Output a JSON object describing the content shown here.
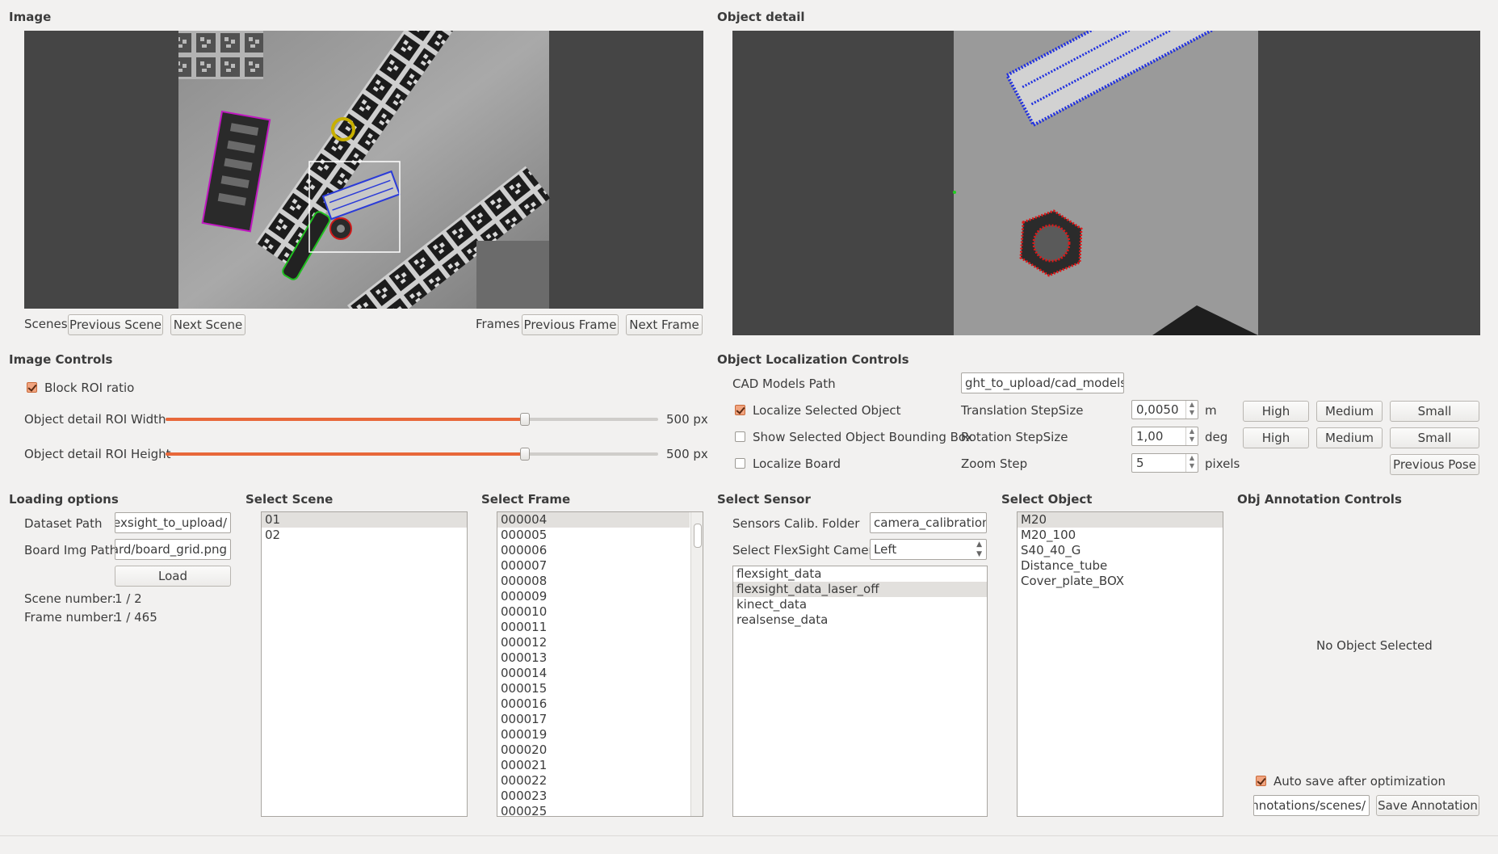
{
  "panels": {
    "image": "Image",
    "object_detail": "Object detail",
    "image_controls": "Image Controls",
    "object_localization": "Object Localization Controls",
    "loading_options": "Loading options",
    "select_scene": "Select Scene",
    "select_frame": "Select Frame",
    "select_sensor": "Select Sensor",
    "select_object": "Select Object",
    "obj_annotation": "Obj Annotation Controls"
  },
  "nav": {
    "scenes_label": "Scenes",
    "prev_scene": "Previous Scene",
    "next_scene": "Next Scene",
    "frames_label": "Frames",
    "prev_frame": "Previous Frame",
    "next_frame": "Next Frame"
  },
  "image_controls": {
    "block_roi_label": "Block ROI ratio",
    "block_roi_checked": true,
    "roi_width_label": "Object detail ROI Width",
    "roi_width_value": "500 px",
    "roi_width_fraction": 0.73,
    "roi_height_label": "Object detail ROI Height",
    "roi_height_value": "500 px",
    "roi_height_fraction": 0.73
  },
  "localization": {
    "cad_label": "CAD Models Path",
    "cad_value": "ght_to_upload/cad_models/",
    "localize_selected": "Localize Selected Object",
    "localize_selected_checked": true,
    "show_bbox": "Show Selected Object Bounding Box",
    "localize_board": "Localize Board",
    "trans_label": "Translation StepSize",
    "trans_value": "0,0050",
    "trans_unit": "m",
    "rot_label": "Rotation StepSize",
    "rot_value": "1,00",
    "rot_unit": "deg",
    "zoom_label": "Zoom Step",
    "zoom_value": "5",
    "zoom_unit": "pixels",
    "high": "High",
    "medium": "Medium",
    "small": "Small",
    "previous_pose": "Previous Pose"
  },
  "loading": {
    "dataset_label": "Dataset Path",
    "dataset_value": "/flexsight_to_upload",
    "board_label": "Board Img Path",
    "board_value": "oard/board_grid.png",
    "load": "Load",
    "scene_number_label": "Scene number:",
    "scene_number_value": "1 / 2",
    "frame_number_label": "Frame number:",
    "frame_number_value": "1 / 465"
  },
  "scenes": [
    "01",
    "02"
  ],
  "frames": [
    "000004",
    "000005",
    "000006",
    "000007",
    "000008",
    "000009",
    "000010",
    "000011",
    "000012",
    "000013",
    "000014",
    "000015",
    "000016",
    "000017",
    "000019",
    "000020",
    "000021",
    "000022",
    "000023",
    "000025"
  ],
  "sensor": {
    "calib_label": "Sensors Calib. Folder",
    "calib_value": "camera_calibrations",
    "camera_label": "Select FlexSight Camera",
    "camera_value": "Left",
    "items": [
      "flexsight_data",
      "flexsight_data_laser_off",
      "kinect_data",
      "realsense_data"
    ]
  },
  "objects": [
    "M20",
    "M20_100",
    "S40_40_G",
    "Distance_tube",
    "Cover_plate_BOX"
  ],
  "annotation": {
    "no_object": "No Object Selected",
    "auto_save": "Auto save after optimization",
    "auto_save_checked": true,
    "path_value": "/annotations/scenes",
    "save": "Save Annotation"
  },
  "colors": {
    "accent": "#e8683a",
    "window_bg": "#f2f1f0",
    "image_bg": "#454545"
  }
}
